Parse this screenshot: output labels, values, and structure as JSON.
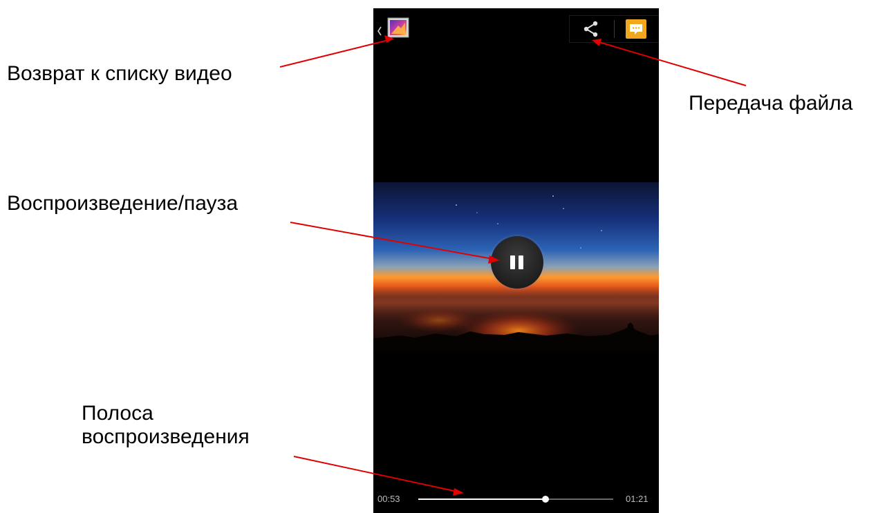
{
  "annotations": {
    "back": "Возврат к списку видео",
    "share": "Передача файла",
    "play_pause": "Воспроизведение/пауза",
    "seek_line1": "Полоса",
    "seek_line2": "воспроизведения"
  },
  "player": {
    "time_current": "00:53",
    "time_total": "01:21",
    "progress": 0.654
  },
  "icons": {
    "back": "chevron-left-icon",
    "gallery": "gallery-thumbnail-icon",
    "share": "share-icon",
    "message": "message-icon",
    "pause": "pause-icon"
  },
  "colors": {
    "arrow": "#e00000",
    "message_button": "#f2a81c",
    "player_background": "#000000"
  }
}
